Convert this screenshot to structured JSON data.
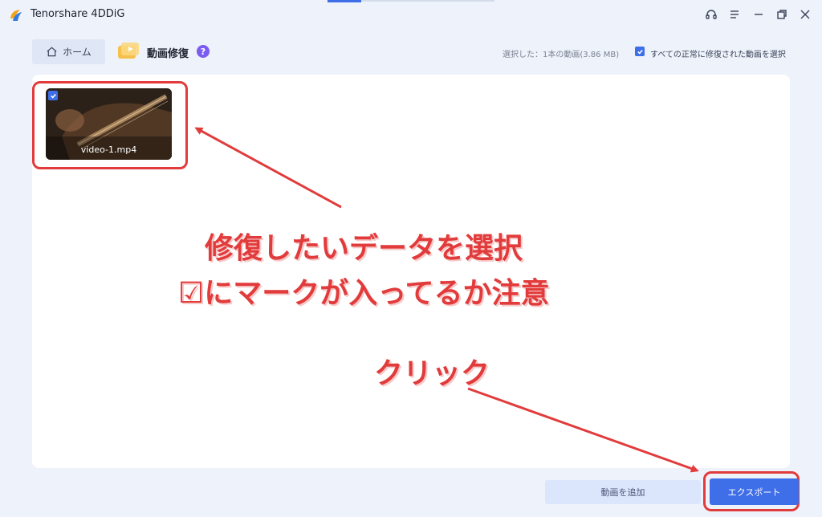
{
  "app": {
    "title": "Tenorshare 4DDiG"
  },
  "window_controls": [
    "headset-icon",
    "menu-icon",
    "minimize-icon",
    "restore-icon",
    "close-icon"
  ],
  "toolbar": {
    "home_label": "ホーム",
    "module_title": "動画修復",
    "help_symbol": "?",
    "selected_info": "選択した：1本の動画(3.86 MB)",
    "select_all_label": "すべての正常に修復された動画を選択",
    "select_all_checked": true
  },
  "videos": [
    {
      "name": "video-1.mp4",
      "checked": true
    }
  ],
  "annotations": {
    "instruction_line1": "修復したいデータを選択",
    "instruction_line2": "☑にマークが入ってるか注意",
    "click_label": "クリック"
  },
  "buttons": {
    "add_video": "動画を追加",
    "export": "エクスポート"
  },
  "colors": {
    "accent": "#3e6ee8",
    "annotation_red": "#e23b3b",
    "background": "#eef2fa",
    "help_purple": "#7b5cf0"
  }
}
